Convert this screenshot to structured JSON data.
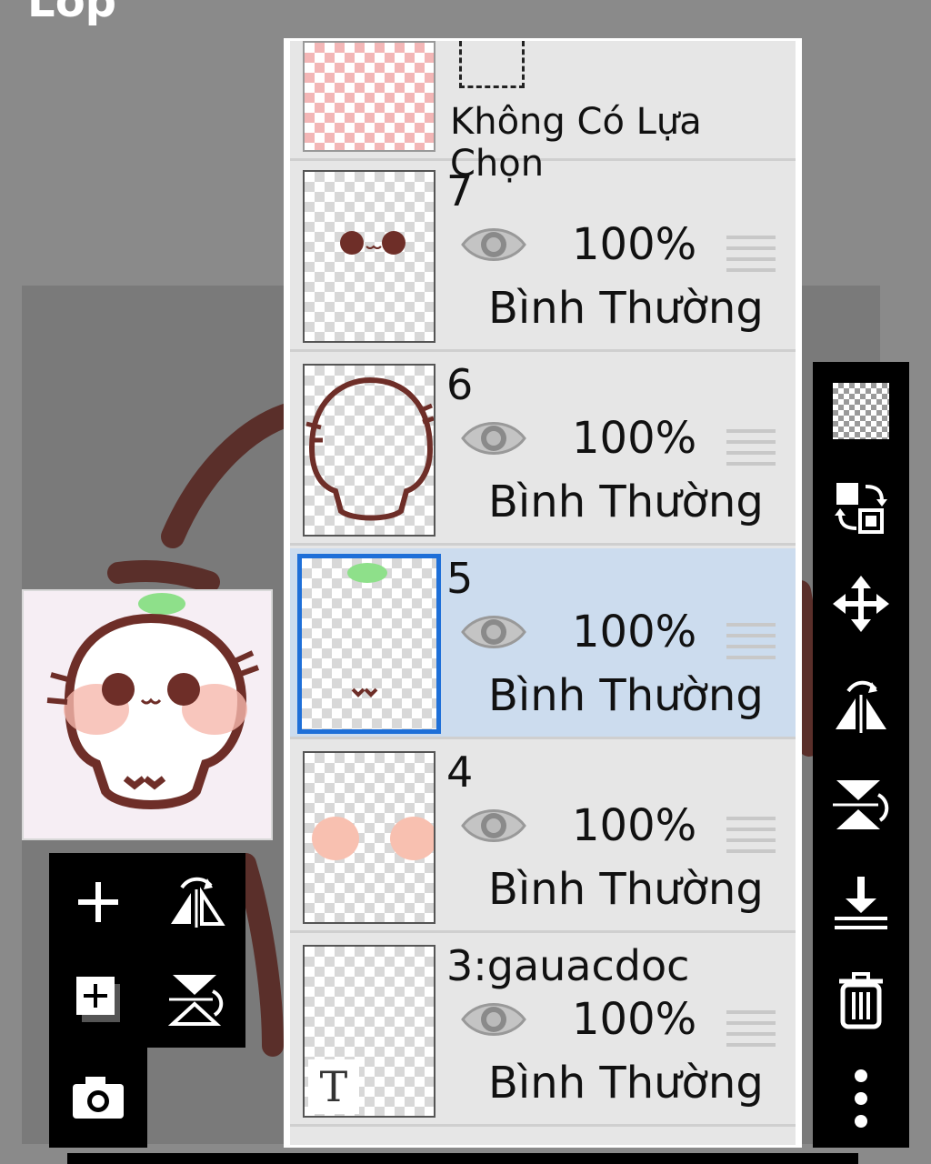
{
  "header": {
    "title": "Lớp"
  },
  "selection_row": {
    "label": "Không Có Lựa Chọn"
  },
  "layers": [
    {
      "name": "7",
      "opacity": "100%",
      "blend": "Bình Thường",
      "selected": false
    },
    {
      "name": "6",
      "opacity": "100%",
      "blend": "Bình Thường",
      "selected": false
    },
    {
      "name": "5",
      "opacity": "100%",
      "blend": "Bình Thường",
      "selected": true
    },
    {
      "name": "4",
      "opacity": "100%",
      "blend": "Bình Thường",
      "selected": false
    },
    {
      "name": "3:gauacdoc",
      "opacity": "100%",
      "blend": "Bình Thường",
      "selected": false
    }
  ],
  "left_toolbar": [
    "add-layer-icon",
    "flip-horizontal-icon",
    "add-layer-copy-icon",
    "flip-vertical-icon",
    "camera-icon"
  ],
  "right_toolbar": [
    "transparency-icon",
    "swap-icon",
    "move-icon",
    "flip-horizontal-icon",
    "flip-vertical-icon",
    "merge-down-icon",
    "trash-icon",
    "more-icon"
  ],
  "colors": {
    "selected_bg": "#ccdcee",
    "selected_border": "#1e6fd8",
    "toolbar_bg": "#000000",
    "ink": "#6e2e28"
  }
}
